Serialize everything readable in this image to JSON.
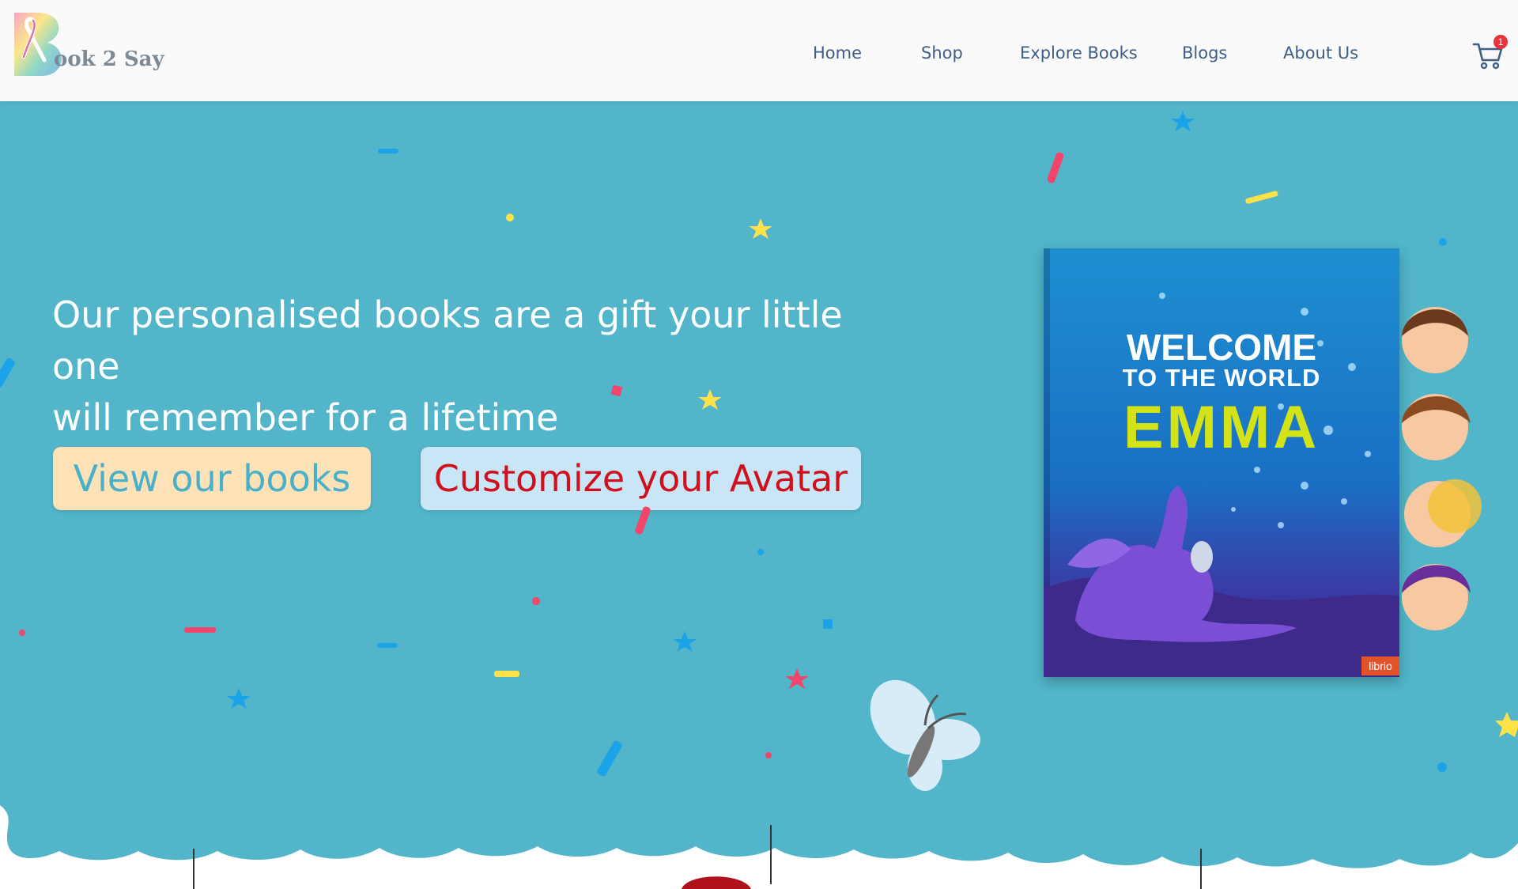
{
  "header": {
    "logo_letter": "B",
    "logo_text": "ook 2 Say",
    "nav": [
      {
        "label": "Home"
      },
      {
        "label": "Shop"
      },
      {
        "label": "Explore Books"
      },
      {
        "label": "Blogs"
      },
      {
        "label": "About Us"
      }
    ],
    "cart_count": "1"
  },
  "hero": {
    "headline_line1": "Our personalised books are a gift your little one",
    "headline_line2": "will remember for a lifetime",
    "buttons": {
      "view_books": "View our books",
      "customize_avatar": "Customize your Avatar"
    },
    "book": {
      "welcome": "WELCOME",
      "to_the_world": "TO THE WORLD",
      "name": "EMMA",
      "publisher": "librio"
    }
  },
  "colors": {
    "hero_background": "#52b5c9",
    "nav_text": "#3f5e86",
    "button_books_bg": "#fde2b8",
    "button_books_text": "#48b0c8",
    "button_avatar_bg": "#c9e6f7",
    "button_avatar_text": "#d0101c",
    "book_name": "#d4e318"
  },
  "icons": [
    "logo-ribbon-icon",
    "cart-icon",
    "butterfly-icon",
    "confetti-star-icon"
  ]
}
